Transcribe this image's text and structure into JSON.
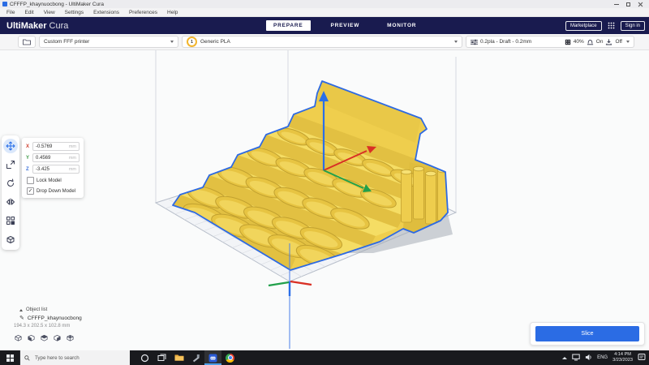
{
  "window": {
    "title": "CFFFP_khaynuocbong - UltiMaker Cura"
  },
  "menu": {
    "items": [
      {
        "label": "File"
      },
      {
        "label": "Edit"
      },
      {
        "label": "View"
      },
      {
        "label": "Settings"
      },
      {
        "label": "Extensions"
      },
      {
        "label": "Preferences"
      },
      {
        "label": "Help"
      }
    ]
  },
  "header": {
    "logo_primary": "UltiMaker",
    "logo_secondary": "Cura",
    "tabs": [
      {
        "label": "PREPARE"
      },
      {
        "label": "PREVIEW"
      },
      {
        "label": "MONITOR"
      }
    ],
    "marketplace": "Marketplace",
    "sign_in": "Sign in"
  },
  "config": {
    "printer_name": "Custom FFF printer",
    "extruder_number": "1",
    "material_name": "Generic PLA",
    "profile_summary": "0.2pla - Draft - 0.2mm",
    "infill_value": "40%",
    "adhesion_value": "On",
    "support_value": "Off"
  },
  "position": {
    "x_label": "X",
    "x_value": "-0.5769",
    "x_unit": "mm",
    "y_label": "Y",
    "y_value": "0.4569",
    "y_unit": "mm",
    "z_label": "Z",
    "z_value": "-3.425",
    "z_unit": "mm",
    "lock_label": "Lock Model",
    "lock_check": "",
    "drop_label": "Drop Down Model",
    "drop_check": "✓"
  },
  "object_list": {
    "title": "Object list",
    "name": "CFFFP_khaynuocbong",
    "dimensions": "194.3 x 202.5 x 102.8 mm"
  },
  "actions": {
    "slice": "Slice"
  },
  "taskbar": {
    "search_placeholder": "Type here to search",
    "language": "ENG",
    "time": "4:14 PM",
    "date": "3/23/2023"
  },
  "icons": {
    "pencil": "✎"
  },
  "colors": {
    "header_navy": "#191b4f",
    "accent_blue": "#2b6ce4",
    "model_yellow": "#efce4d",
    "selection_blue": "#2e6ae2"
  }
}
